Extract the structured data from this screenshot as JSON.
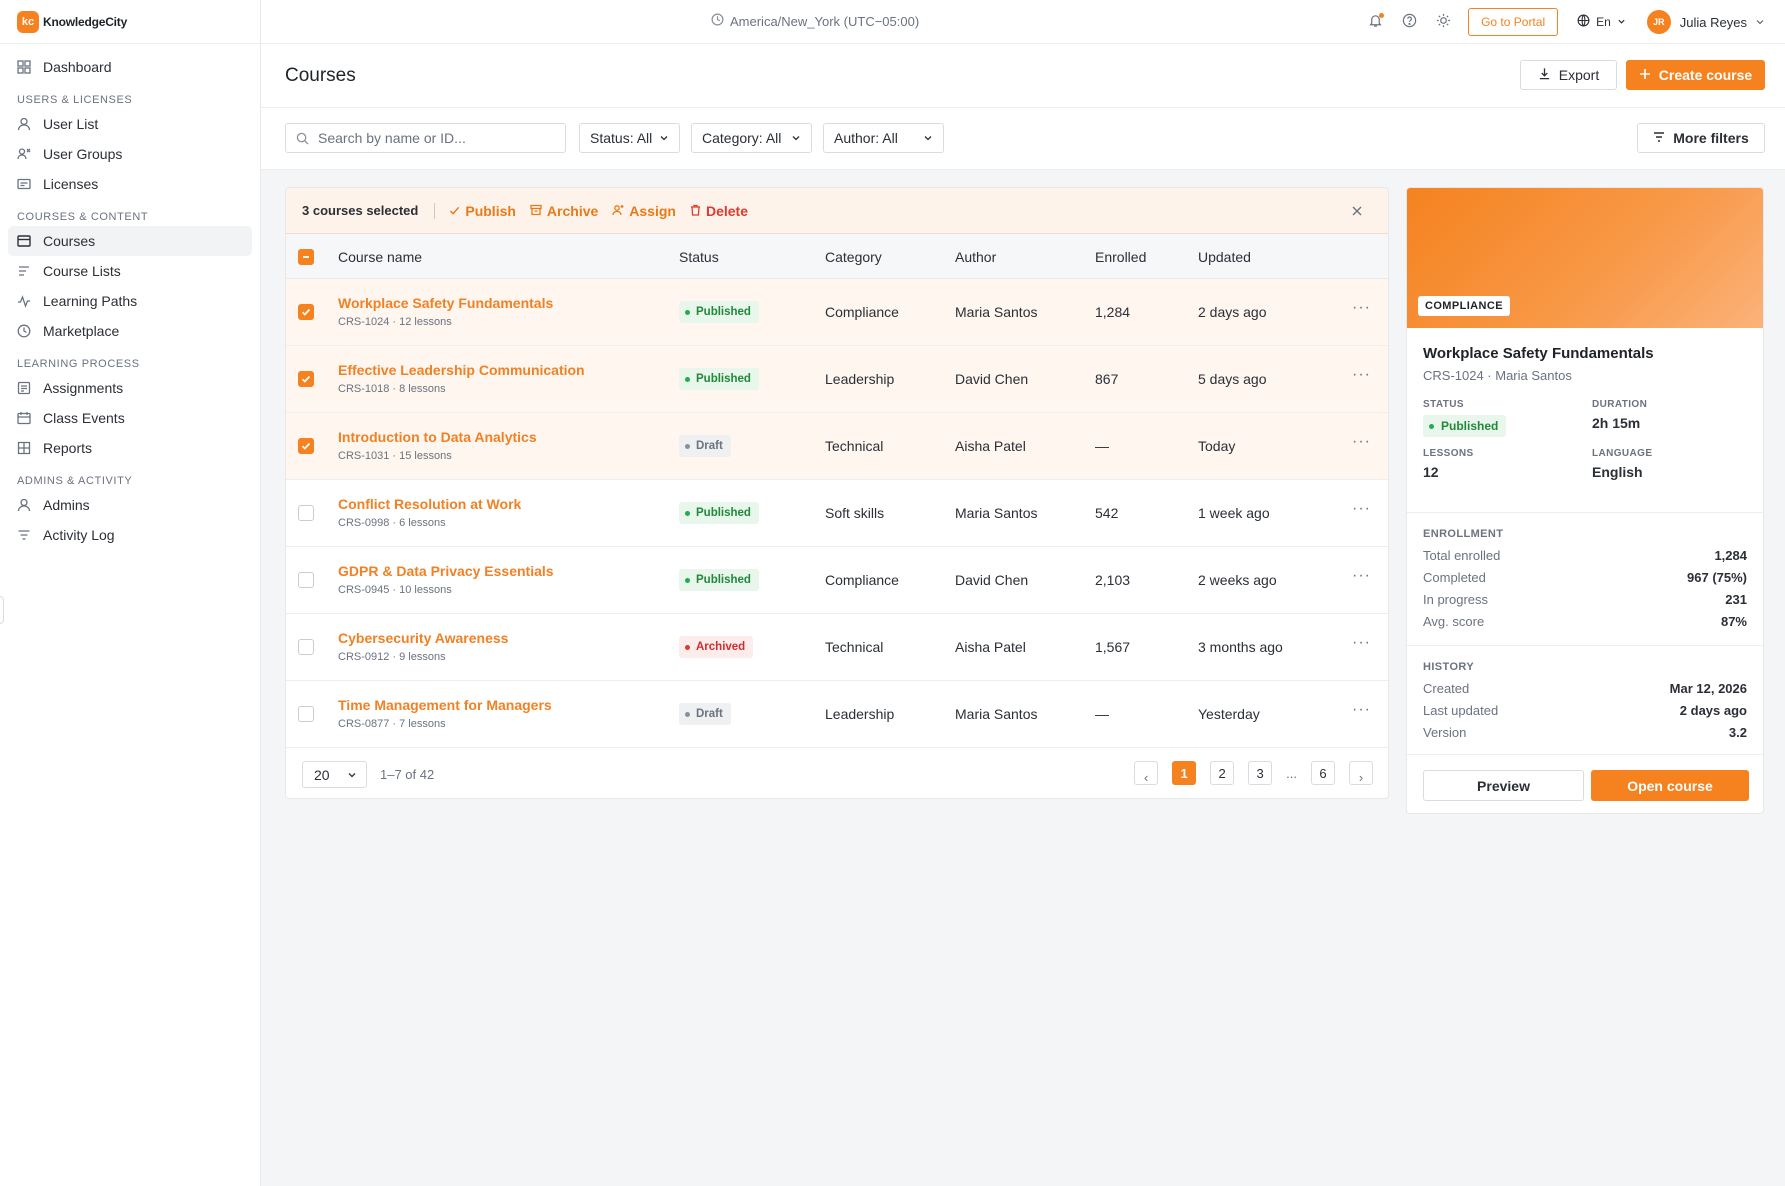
{
  "app": {
    "logo_mark": "kc",
    "logo_text": "KnowledgeCity"
  },
  "sidebar": {
    "dashboard": "Dashboard",
    "sections": [
      {
        "title": "Users & Licenses",
        "items": [
          "User List",
          "User Groups",
          "Licenses"
        ]
      },
      {
        "title": "Courses & Content",
        "items": [
          "Courses",
          "Course Lists",
          "Learning Paths",
          "Marketplace"
        ]
      },
      {
        "title": "Learning Process",
        "items": [
          "Assignments",
          "Class Events",
          "Reports"
        ]
      },
      {
        "title": "Admins & Activity",
        "items": [
          "Admins",
          "Activity Log"
        ]
      }
    ],
    "active_item": "Courses"
  },
  "topbar": {
    "timezone": "America/New_York (UTC−05:00)",
    "portal_button": "Go to Portal",
    "language": "En",
    "user_initials": "JR",
    "user_name": "Julia Reyes"
  },
  "header": {
    "title": "Courses",
    "export_label": "Export",
    "create_label": "Create course"
  },
  "filters": {
    "search_placeholder": "Search by name or ID...",
    "status": "Status: All",
    "category": "Category: All",
    "author": "Author: All",
    "more_filters": "More filters"
  },
  "bulk": {
    "count_label": "3 courses selected",
    "publish": "Publish",
    "archive": "Archive",
    "assign": "Assign",
    "delete": "Delete"
  },
  "table": {
    "columns": {
      "name": "Course name",
      "status": "Status",
      "category": "Category",
      "author": "Author",
      "enrolled": "Enrolled",
      "updated": "Updated"
    },
    "rows": [
      {
        "name": "Workplace Safety Fundamentals",
        "meta": "CRS-1024 · 12 lessons",
        "status": "Published",
        "category": "Compliance",
        "author": "Maria Santos",
        "enrolled": "1,284",
        "updated": "2 days ago",
        "selected": true
      },
      {
        "name": "Effective Leadership Communication",
        "meta": "CRS-1018 · 8 lessons",
        "status": "Published",
        "category": "Leadership",
        "author": "David Chen",
        "enrolled": "867",
        "updated": "5 days ago",
        "selected": true
      },
      {
        "name": "Introduction to Data Analytics",
        "meta": "CRS-1031 · 15 lessons",
        "status": "Draft",
        "category": "Technical",
        "author": "Aisha Patel",
        "enrolled": "—",
        "updated": "Today",
        "selected": true
      },
      {
        "name": "Conflict Resolution at Work",
        "meta": "CRS-0998 · 6 lessons",
        "status": "Published",
        "category": "Soft skills",
        "author": "Maria Santos",
        "enrolled": "542",
        "updated": "1 week ago",
        "selected": false
      },
      {
        "name": "GDPR & Data Privacy Essentials",
        "meta": "CRS-0945 · 10 lessons",
        "status": "Published",
        "category": "Compliance",
        "author": "David Chen",
        "enrolled": "2,103",
        "updated": "2 weeks ago",
        "selected": false
      },
      {
        "name": "Cybersecurity Awareness",
        "meta": "CRS-0912 · 9 lessons",
        "status": "Archived",
        "category": "Technical",
        "author": "Aisha Patel",
        "enrolled": "1,567",
        "updated": "3 months ago",
        "selected": false
      },
      {
        "name": "Time Management for Managers",
        "meta": "CRS-0877 · 7 lessons",
        "status": "Draft",
        "category": "Leadership",
        "author": "Maria Santos",
        "enrolled": "—",
        "updated": "Yesterday",
        "selected": false
      }
    ],
    "more_glyph": "···"
  },
  "pagination": {
    "page_size": "20",
    "range": "1–7 of 42",
    "prev": "‹",
    "pages": [
      "1",
      "2",
      "3"
    ],
    "ellipsis": "...",
    "last_page": "6",
    "next": "›",
    "current": "1"
  },
  "detail": {
    "tag": "COMPLIANCE",
    "title": "Workplace Safety Fundamentals",
    "subtitle": "CRS-1024 · Maria Santos",
    "status_label": "Status",
    "status_value": "Published",
    "duration_label": "Duration",
    "duration_value": "2h 15m",
    "lessons_label": "Lessons",
    "lessons_value": "12",
    "language_label": "Language",
    "language_value": "English",
    "enrollment_title": "Enrollment",
    "enrollment": [
      {
        "k": "Total enrolled",
        "v": "1,284"
      },
      {
        "k": "Completed",
        "v": "967 (75%)"
      },
      {
        "k": "In progress",
        "v": "231"
      },
      {
        "k": "Avg. score",
        "v": "87%"
      }
    ],
    "history_title": "History",
    "history": [
      {
        "k": "Created",
        "v": "Mar 12, 2026"
      },
      {
        "k": "Last updated",
        "v": "2 days ago"
      },
      {
        "k": "Version",
        "v": "3.2"
      }
    ],
    "preview_label": "Preview",
    "open_label": "Open course"
  },
  "colors": {
    "accent": "#f5821f",
    "published": "#1fae4b",
    "archived": "#dc3b2e",
    "draft": "#8a9099"
  }
}
